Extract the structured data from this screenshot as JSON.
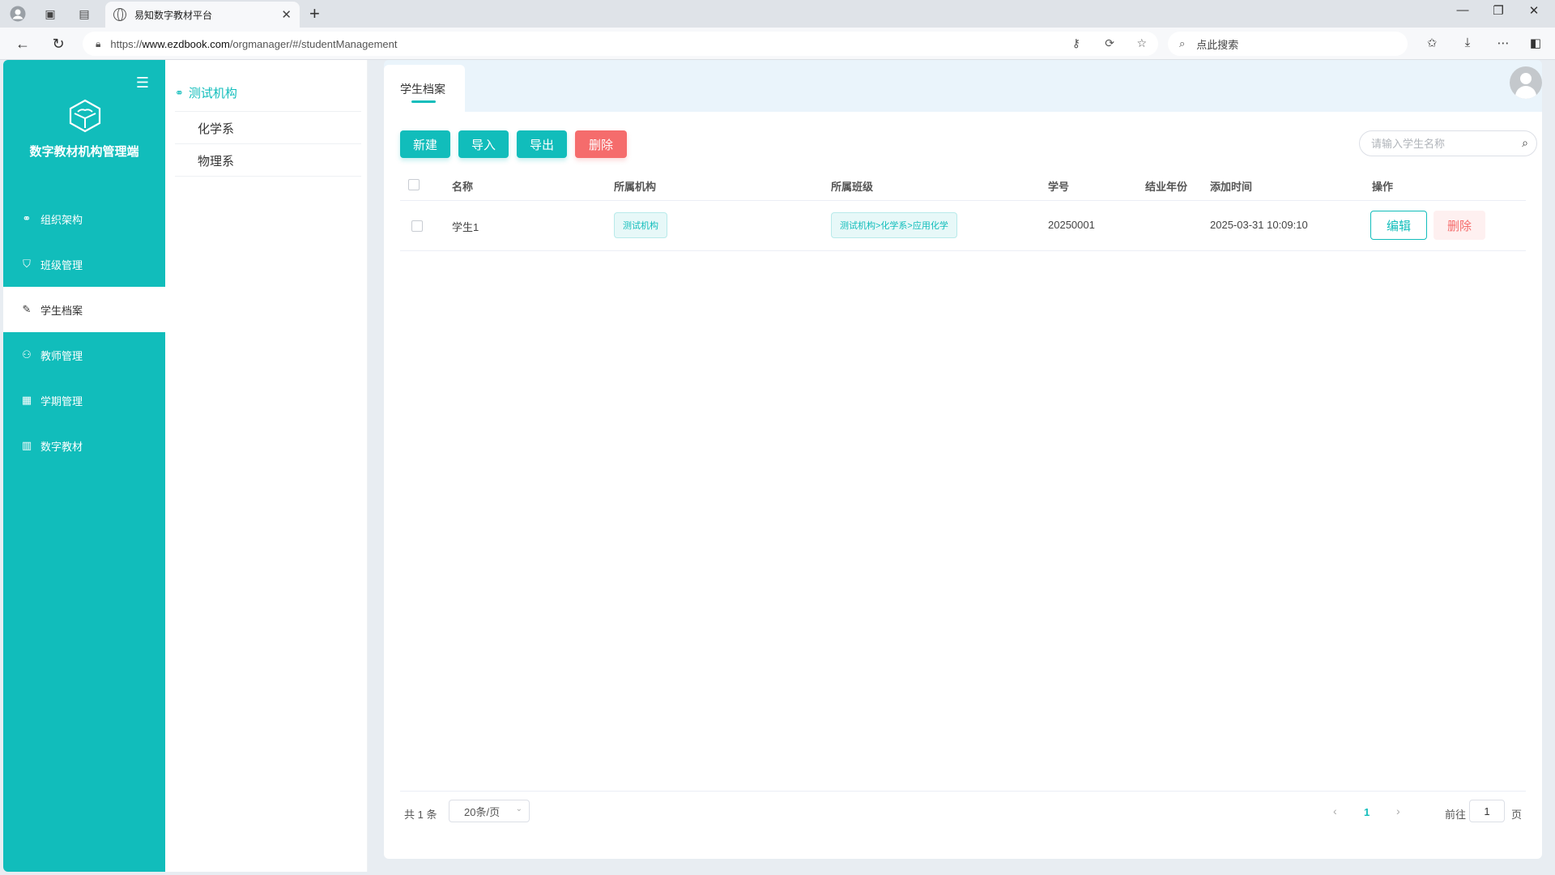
{
  "browser": {
    "tab_title": "易知数字教材平台",
    "url_prefix": "https://",
    "url_domain": "www.ezdbook.com",
    "url_path": "/orgmanager/#/studentManagement",
    "search_placeholder": "点此搜索"
  },
  "sidebar": {
    "brand": "数字教材机构管理端",
    "items": [
      {
        "label": "组织架构",
        "icon": "org-structure-icon"
      },
      {
        "label": "班级管理",
        "icon": "class-icon"
      },
      {
        "label": "学生档案",
        "icon": "student-file-icon",
        "active": true
      },
      {
        "label": "教师管理",
        "icon": "teacher-icon"
      },
      {
        "label": "学期管理",
        "icon": "calendar-icon"
      },
      {
        "label": "数字教材",
        "icon": "books-icon"
      }
    ]
  },
  "org_tree": {
    "root": "测试机构",
    "children": [
      "化学系",
      "物理系"
    ]
  },
  "page_tab": "学生档案",
  "toolbar": {
    "new_label": "新建",
    "import_label": "导入",
    "export_label": "导出",
    "delete_label": "删除",
    "search_placeholder": "请输入学生名称"
  },
  "table": {
    "columns": [
      "名称",
      "所属机构",
      "所属班级",
      "学号",
      "结业年份",
      "添加时间",
      "操作"
    ],
    "rows": [
      {
        "name": "学生1",
        "org": "测试机构",
        "class": "测试机构>化学系>应用化学",
        "student_no": "20250001",
        "grad_year": "",
        "added": "2025-03-31 10:09:10",
        "edit_label": "编辑",
        "delete_label": "删除"
      }
    ]
  },
  "pagination": {
    "total": "共 1 条",
    "page_size": "20条/页",
    "current_page": "1",
    "goto_label": "前往",
    "goto_value": "1",
    "page_suffix": "页"
  },
  "colors": {
    "accent": "#11bdbb",
    "danger": "#f56c6c"
  }
}
